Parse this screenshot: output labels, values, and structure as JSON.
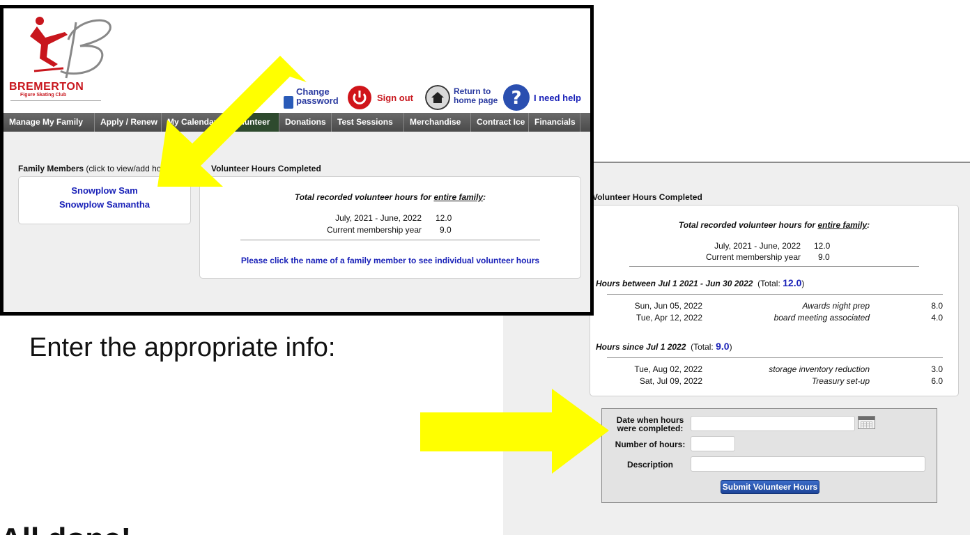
{
  "colors": {
    "accent_blue": "#1a22b8",
    "arrow_yellow": "#ffff00",
    "brand_red": "#c8161d",
    "nav_bg": "#555555"
  },
  "logo": {
    "name": "BREMERTON",
    "tagline": "Figure Skating Club"
  },
  "header": {
    "change_password": "Change password",
    "sign_out": "Sign out",
    "return_home": "Return to home page",
    "help": "I need help"
  },
  "nav": [
    "Manage My Family",
    "Apply / Renew",
    "My Calendar",
    "Volunteer",
    "Donations",
    "Test Sessions",
    "Merchandise",
    "Contract Ice",
    "Financials"
  ],
  "family": {
    "title_bold": "Family Members",
    "title_rest": " (click to view/add hours)",
    "members": [
      "Snowplow Sam",
      "Snowplow Samantha"
    ]
  },
  "volunteer": {
    "title": "Volunteer Hours Completed",
    "total_heading_pre": "Total recorded volunteer hours for ",
    "total_heading_em": "entire family",
    "total_heading_post": ":",
    "years": [
      {
        "label": "July, 2021 - June, 2022",
        "hours": "12.0"
      },
      {
        "label": "Current membership year",
        "hours": "9.0"
      }
    ],
    "click_hint": "Please click the name of a family member to see individual volunteer hours"
  },
  "detail": {
    "title": "Volunteer Hours Completed",
    "sections": [
      {
        "heading": "Hours between Jul 1 2021 - Jun 30 2022",
        "total_label": "(Total: ",
        "total": "12.0",
        "total_close": ")",
        "rows": [
          {
            "date": "Sun, Jun 05, 2022",
            "desc": "Awards night prep",
            "hours": "8.0"
          },
          {
            "date": "Tue, Apr 12, 2022",
            "desc": "board meeting associated",
            "hours": "4.0"
          }
        ]
      },
      {
        "heading": "Hours since Jul 1 2022",
        "total_label": "(Total: ",
        "total": "9.0",
        "total_close": ")",
        "rows": [
          {
            "date": "Tue, Aug 02, 2022",
            "desc": "storage inventory reduction",
            "hours": "3.0"
          },
          {
            "date": "Sat, Jul 09, 2022",
            "desc": "Treasury set-up",
            "hours": "6.0"
          }
        ]
      }
    ]
  },
  "form": {
    "date_label": "Date when hours were completed:",
    "hours_label": "Number of hours:",
    "desc_label": "Description",
    "date_value": "",
    "hours_value": "",
    "desc_value": "",
    "submit": "Submit Volunteer Hours"
  },
  "captions": {
    "enter": "Enter the appropriate info:",
    "done": "All done!"
  }
}
